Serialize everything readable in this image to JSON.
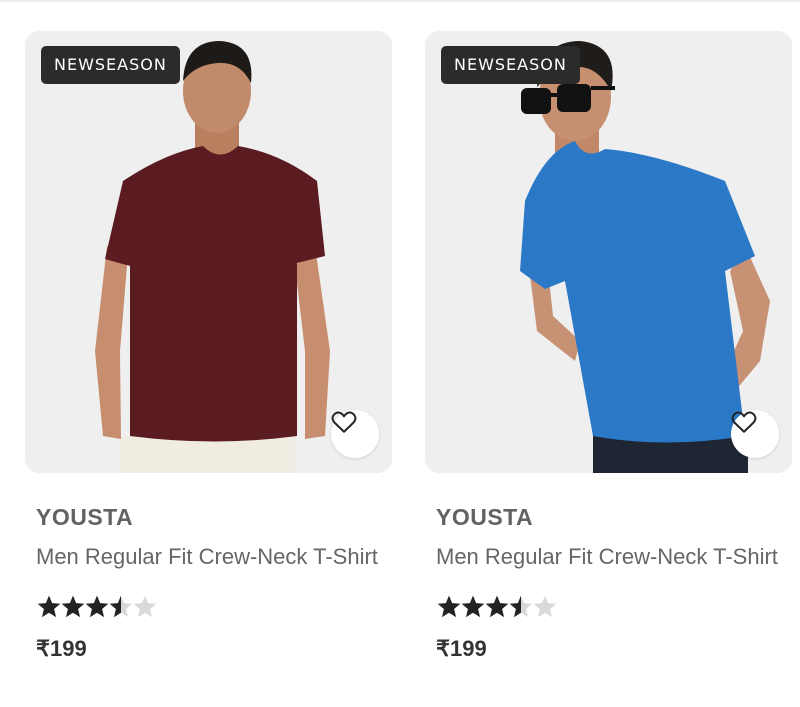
{
  "products": [
    {
      "badge": "NEWSEASON",
      "brand": "YOUSTA",
      "title": "Men Regular Fit Crew-Neck T-Shirt",
      "rating": 3.5,
      "rating_max": 5,
      "price": "₹199",
      "shirt_color": "#5a1c21",
      "wishlist_icon": "heart-outline-icon"
    },
    {
      "badge": "NEWSEASON",
      "brand": "YOUSTA",
      "title": "Men Regular Fit Crew-Neck T-Shirt",
      "rating": 3.5,
      "rating_max": 5,
      "price": "₹199",
      "shirt_color": "#2b78c6",
      "wishlist_icon": "heart-outline-icon"
    }
  ]
}
